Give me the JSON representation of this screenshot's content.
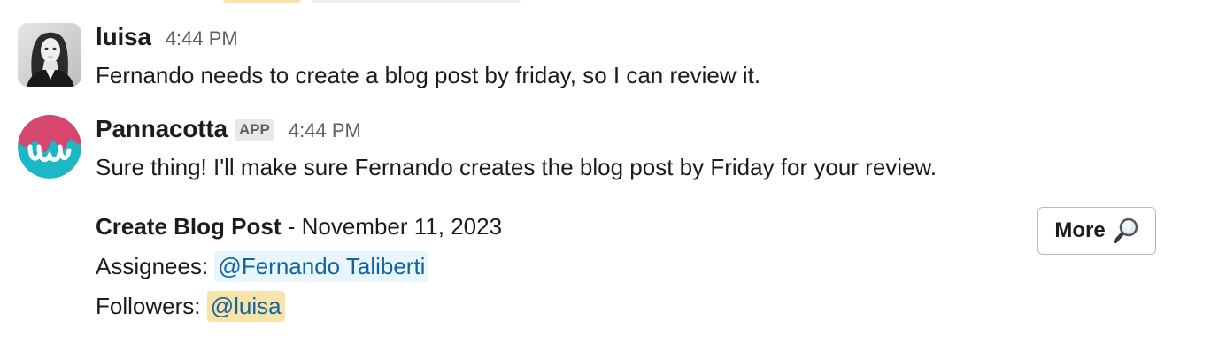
{
  "messages": [
    {
      "author": "luisa",
      "timestamp": "4:44 PM",
      "text": "Fernando needs to create a blog post by friday, so I can review it."
    },
    {
      "author": "Pannacotta",
      "badge": "APP",
      "timestamp": "4:44 PM",
      "text": "Sure thing! I'll make sure Fernando creates the blog post by Friday for your review.",
      "attachment": {
        "title": "Create Blog Post",
        "date": " - November 11, 2023",
        "assignees_label": "Assignees:",
        "assignee": "@Fernando Taliberti",
        "followers_label": "Followers:",
        "follower": "@luisa",
        "more_button_label": "More",
        "more_button_icon": "magnifier-icon"
      }
    }
  ],
  "colors": {
    "mention_text": "#1264a3",
    "mention_bg": "#e8f5fa",
    "self_mention_bg": "#f8e3a8",
    "app_logo_pink": "#d6466f",
    "app_logo_teal": "#1eb7c6"
  }
}
